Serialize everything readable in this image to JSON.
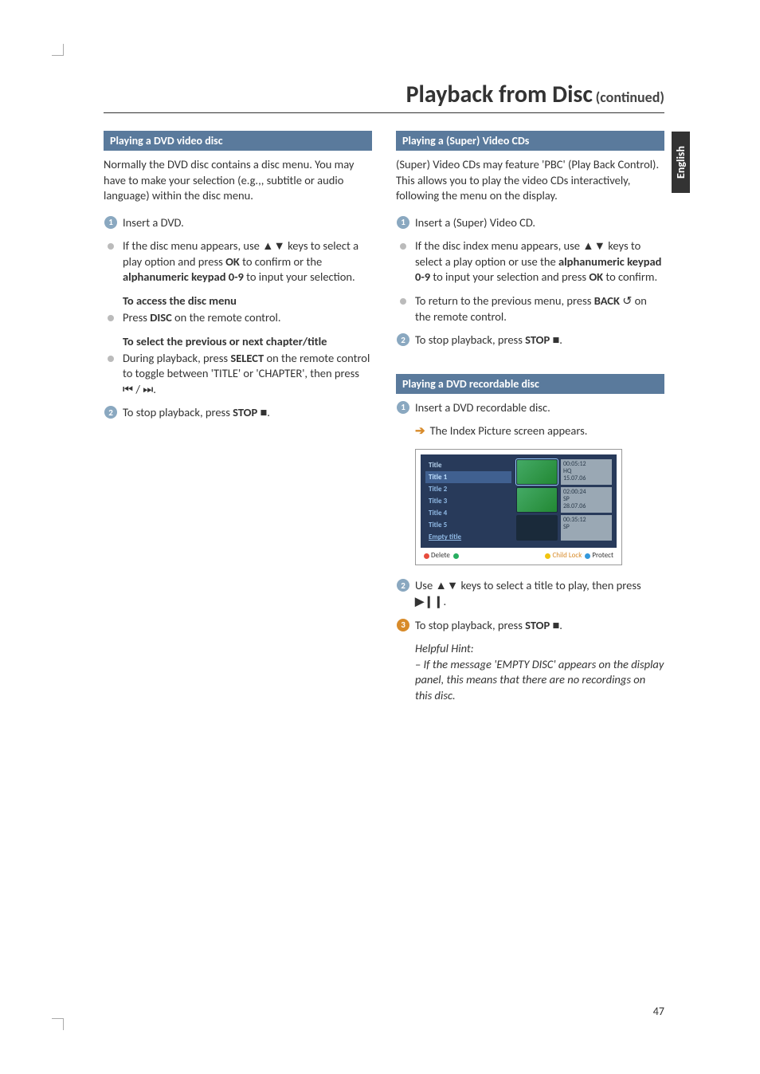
{
  "lang_tab": "English",
  "page_number": "47",
  "title": {
    "main": "Playback from Disc",
    "sub": "(continued)"
  },
  "left": {
    "h1": "Playing a DVD video disc",
    "intro": "Normally the DVD disc contains a disc menu. You may have to make your selection (e.g.,, subtitle or audio language) within the disc menu.",
    "s1": "Insert a DVD.",
    "b1_a": "If the disc menu appears, use ",
    "b1_b": " keys to select a play option and press ",
    "b1_ok": "OK",
    "b1_c": " to confirm or the ",
    "b1_kp": "alphanumeric keypad 0-9",
    "b1_d": " to input your selection.",
    "sub1": "To access the disc menu",
    "b2_a": "Press ",
    "b2_disc": "DISC",
    "b2_b": " on the remote control.",
    "sub2": "To select the previous or next chapter/title",
    "b3_a": "During playback, press ",
    "b3_sel": "SELECT",
    "b3_b": " on the remote control to toggle between 'TITLE' or 'CHAPTER', then press ",
    "b3_c": " / ",
    "b3_d": ".",
    "s2_a": "To stop playback, press ",
    "s2_stop": "STOP",
    "s2_b": "."
  },
  "right": {
    "h1": "Playing a (Super) Video CDs",
    "intro": "(Super) Video CDs may feature 'PBC' (Play Back Control). This allows you to play the video CDs interactively, following the menu on the display.",
    "s1": "Insert a (Super) Video CD.",
    "b1_a": "If the disc index menu appears, use ",
    "b1_b": " keys to select a play option or use the ",
    "b1_kp": "alphanumeric keypad 0-9",
    "b1_c": " to input your selection and press ",
    "b1_ok": "OK",
    "b1_d": " to confirm.",
    "b2_a": "To return to the previous menu, press ",
    "b2_back": "BACK",
    "b2_b": " on the remote control.",
    "s2_a": "To stop playback, press ",
    "s2_stop": "STOP",
    "s2_b": ".",
    "h2": "Playing a DVD recordable disc",
    "s3": "Insert a DVD recordable disc.",
    "r1": "The Index Picture screen appears.",
    "s4_a": "Use ",
    "s4_b": " keys to select a title to play, then press ",
    "s4_c": ".",
    "s5_a": "To stop playback, press ",
    "s5_stop": "STOP",
    "s5_b": ".",
    "hint_h": "Helpful Hint:",
    "hint": "– If the message 'EMPTY DISC' appears on the display panel, this means that there are no recordings on this disc."
  },
  "index": {
    "header": "Title",
    "rows": [
      "Title 1",
      "Title 2",
      "Title 3",
      "Title 4",
      "Title 5",
      "Empty title"
    ],
    "meta1": {
      "t": "00:05:12",
      "q": "HQ",
      "d": "15.07.06"
    },
    "meta2": {
      "t": "02:00:24",
      "q": "SP",
      "d": "28.07.06"
    },
    "meta3": {
      "t": "00:35:12",
      "q": "SP"
    },
    "footer": {
      "delete": "Delete",
      "childlock": "Child Lock",
      "protect": "Protect"
    }
  },
  "icons": {
    "updown": "▲▼",
    "prev": "⏮",
    "next": "⏭",
    "stop": "■",
    "back": "↺",
    "play": "▶❙❙"
  }
}
